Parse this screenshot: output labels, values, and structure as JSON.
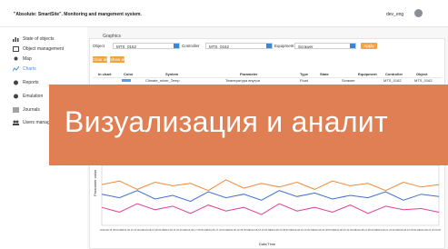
{
  "app": {
    "title": "\"Absolute: SmartSite\". Monitoring and mangement system.",
    "user": "dev_eng"
  },
  "sidebar": {
    "items": [
      {
        "label": "State of objects",
        "icon": "chart-bars-icon"
      },
      {
        "label": "Object management",
        "icon": "window-icon"
      },
      {
        "label": "Map",
        "icon": "map-pin-icon"
      },
      {
        "label": "Charts",
        "icon": "line-chart-icon",
        "active": true
      },
      {
        "label": "Reports",
        "icon": "gear-icon"
      },
      {
        "label": "Emulation",
        "icon": "gear-icon"
      },
      {
        "label": "Journals",
        "icon": "list-icon"
      },
      {
        "label": "Users manager",
        "icon": "users-icon"
      }
    ]
  },
  "tab": {
    "title": "Graphics"
  },
  "filters": {
    "object_label": "Object",
    "object_value": "MTS_0162",
    "controller_label": "Controller",
    "controller_value": "MTS_0162",
    "equipment_label": "Equipment",
    "equipment_value": "Scrawer",
    "button": "Apply"
  },
  "actions": {
    "clear_all": "Clear all",
    "show_all": "Show all"
  },
  "table": {
    "headers": [
      "In chart",
      "Color",
      "System",
      "Parameter",
      "Type",
      "State",
      "Equipment",
      "Controller",
      "Object"
    ],
    "rows": [
      [
        "",
        "",
        "Climate_mixer_Temp",
        "Температура внутри",
        "Float",
        "",
        "Scrawer",
        "MTS_0162",
        "MTS_0162"
      ]
    ]
  },
  "banner": {
    "text": "Визуализация и аналит"
  },
  "chart_data": {
    "type": "line",
    "xlabel": "Date/Time",
    "ylabel": "Parameter value",
    "x_ticks": [
      "2019-08-15 08:00:00",
      "2019-08-15 20:00:00",
      "2019-08-16 08:00:00",
      "2019-08-16 20:00:00",
      "2019-08-17 08:00:00",
      "2019-08-17 20:00:00",
      "2019-08-18 08:00:00",
      "2019-08-18 20:00:00",
      "2019-08-19 08:00:00",
      "2019-08-19 20:00:00",
      "2019-08-20 08:00:00",
      "2019-08-20 20:00:00",
      "2019-08-21 08:00:00",
      "2019-08-21 20:00:00",
      "2019-08-22 08:00:00",
      "2019-08-22 20:00:00"
    ],
    "series": [
      {
        "color": "#f08a3c",
        "values": [
          68,
          74,
          60,
          72,
          66,
          70,
          58,
          76,
          62,
          70,
          64,
          72,
          60,
          74,
          66,
          70,
          58,
          72,
          64,
          68
        ]
      },
      {
        "color": "#3f6fd1",
        "values": [
          52,
          46,
          58,
          44,
          50,
          40,
          56,
          46,
          52,
          42,
          58,
          48,
          54,
          44,
          50,
          46,
          56,
          42,
          52,
          48
        ]
      },
      {
        "color": "#e0409a",
        "values": [
          30,
          22,
          36,
          26,
          32,
          20,
          34,
          24,
          30,
          18,
          36,
          24,
          30,
          22,
          34,
          20,
          32,
          26,
          28,
          22
        ]
      }
    ]
  },
  "colors": {
    "accent": "#3b87d6",
    "orange_button": "#f3a33c",
    "banner": "#e07f53"
  }
}
